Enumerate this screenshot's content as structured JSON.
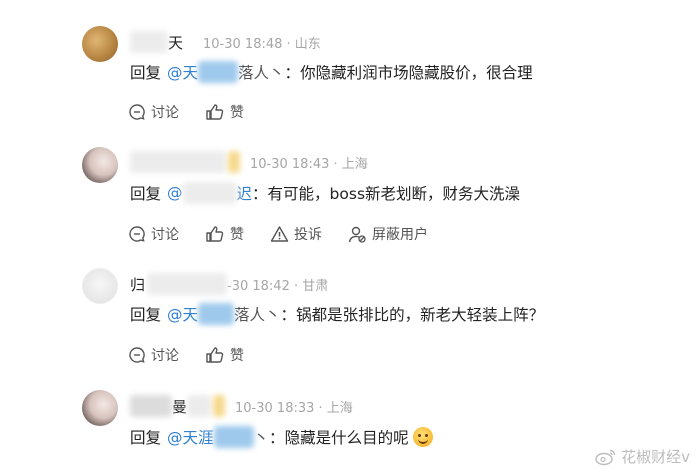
{
  "comments": [
    {
      "name_visible": "天",
      "timestamp": "10-30 18:48 · 山东",
      "reply_prefix": "回复",
      "mention_start": "@天",
      "mention_end": "落人丶",
      "separator": "：",
      "text": "你隐藏利润市场隐藏股价，很合理",
      "actions": {
        "discuss": "讨论",
        "like": "赞"
      }
    },
    {
      "timestamp": "10-30 18:43 · 上海",
      "reply_prefix": "回复",
      "mention_start": "@",
      "mention_end": "迟",
      "separator": "：",
      "text": "有可能，boss新老划断，财务大洗澡",
      "actions": {
        "discuss": "讨论",
        "like": "赞",
        "report": "投诉",
        "block": "屏蔽用户"
      }
    },
    {
      "name_visible": "归",
      "timestamp": "-30 18:42 · 甘肃",
      "reply_prefix": "回复",
      "mention_start": "@天",
      "mention_end": "落人丶",
      "separator": "：",
      "text": "锅都是张排比的，新老大轻装上阵？",
      "actions": {
        "discuss": "讨论",
        "like": "赞"
      }
    },
    {
      "name_visible": "曼",
      "timestamp": "10-30 18:33 · 上海",
      "reply_prefix": "回复",
      "mention_start": "@天涯",
      "mention_end": "丶",
      "separator": "：",
      "text": "隐藏是什么目的呢",
      "emoji": "grin-emoji"
    }
  ],
  "watermark": {
    "text": "花椒财经v"
  },
  "colors": {
    "mention": "#2f7fd3",
    "meta": "#a6a6a6",
    "text": "#222222",
    "action": "#555555"
  }
}
